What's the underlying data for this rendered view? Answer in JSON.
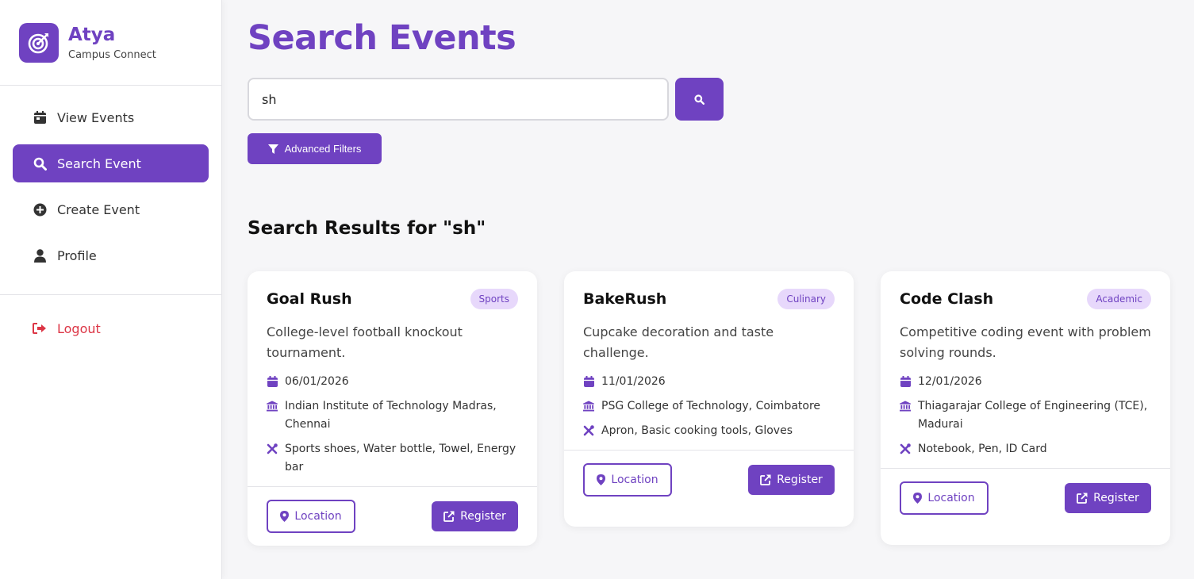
{
  "brand": {
    "name": "Atya",
    "subtitle": "Campus Connect",
    "logo_icon": "target-arrow-icon",
    "accent": "#6f42c1"
  },
  "sidebar": {
    "items": [
      {
        "label": "View Events",
        "icon": "calendar-icon",
        "active": false
      },
      {
        "label": "Search Event",
        "icon": "search-icon",
        "active": true
      },
      {
        "label": "Create Event",
        "icon": "plus-circle-icon",
        "active": false
      },
      {
        "label": "Profile",
        "icon": "user-icon",
        "active": false
      }
    ],
    "logout_label": "Logout",
    "logout_color": "#dc3545"
  },
  "main": {
    "title": "Search Events",
    "search": {
      "value": "sh",
      "placeholder": ""
    },
    "filter_label": "Advanced Filters",
    "results_title": "Search Results for \"sh\""
  },
  "events": [
    {
      "title": "Goal Rush",
      "category": "Sports",
      "description": "College-level football knockout tournament.",
      "date": "06/01/2026",
      "venue": "Indian Institute of Technology Madras, Chennai",
      "requirements": "Sports shoes, Water bottle, Towel, Energy bar",
      "location_label": "Location",
      "register_label": "Register"
    },
    {
      "title": "BakeRush",
      "category": "Culinary",
      "description": "Cupcake decoration and taste challenge.",
      "date": "11/01/2026",
      "venue": "PSG College of Technology, Coimbatore",
      "requirements": "Apron, Basic cooking tools, Gloves",
      "location_label": "Location",
      "register_label": "Register"
    },
    {
      "title": "Code Clash",
      "category": "Academic",
      "description": "Competitive coding event with problem solving rounds.",
      "date": "12/01/2026",
      "venue": "Thiagarajar College of Engineering (TCE), Madurai",
      "requirements": "Notebook, Pen, ID Card",
      "location_label": "Location",
      "register_label": "Register"
    }
  ]
}
